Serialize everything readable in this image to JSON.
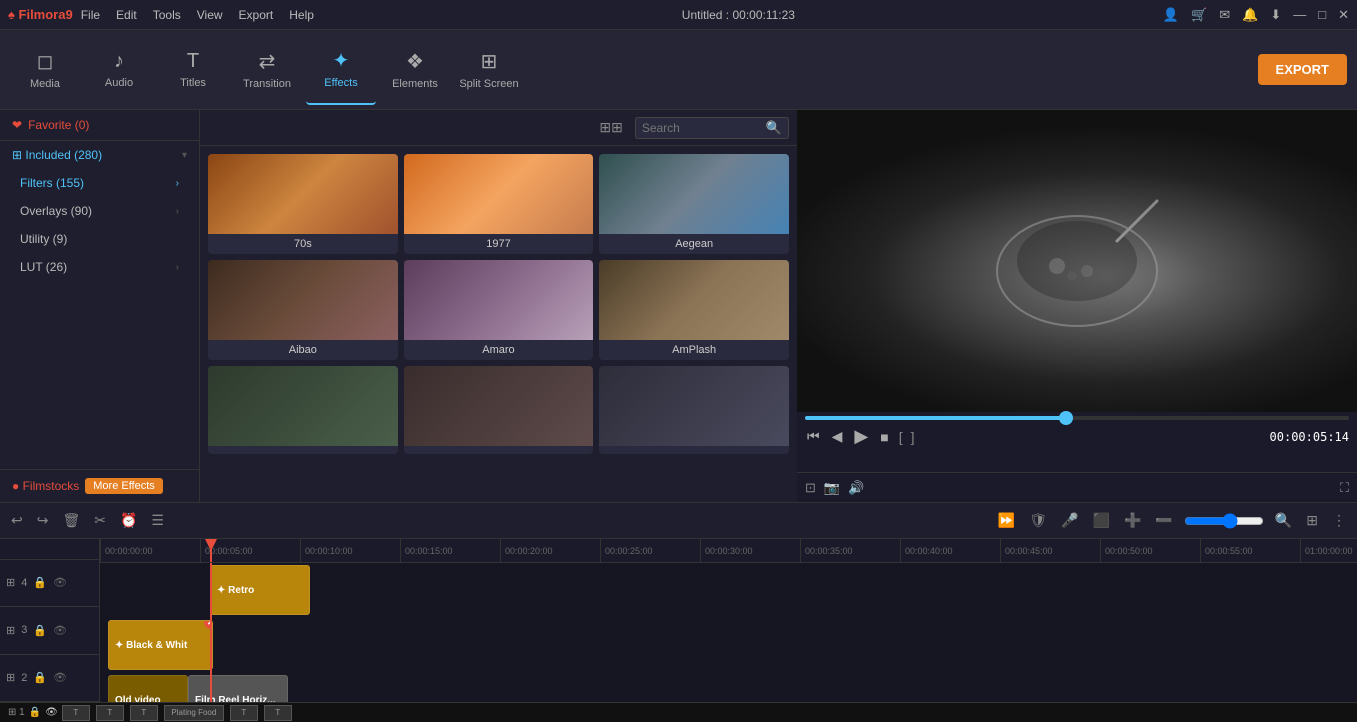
{
  "titlebar": {
    "logo": "♠ Filmora9",
    "menus": [
      "File",
      "Edit",
      "Tools",
      "View",
      "Export",
      "Help"
    ],
    "title": "Untitled : 00:00:11:23",
    "controls": [
      "👤",
      "🛒",
      "✉",
      "🔔",
      "⬇",
      "—",
      "□",
      "✕"
    ]
  },
  "toolbar": {
    "buttons": [
      {
        "id": "media",
        "icon": "◻",
        "label": "Media"
      },
      {
        "id": "audio",
        "icon": "♪",
        "label": "Audio"
      },
      {
        "id": "titles",
        "icon": "T",
        "label": "Titles"
      },
      {
        "id": "transition",
        "icon": "⇄",
        "label": "Transition"
      },
      {
        "id": "effects",
        "icon": "✦",
        "label": "Effects"
      },
      {
        "id": "elements",
        "icon": "❖",
        "label": "Elements"
      },
      {
        "id": "split-screen",
        "icon": "⊞",
        "label": "Split Screen"
      }
    ],
    "export_label": "EXPORT"
  },
  "left_panel": {
    "favorite": "❤ Favorite (0)",
    "categories": [
      {
        "label": "Included (280)",
        "arrow": "▾",
        "active": true
      },
      {
        "label": "Filters (155)",
        "arrow": "›",
        "active": true,
        "indent": true
      },
      {
        "label": "Overlays (90)",
        "arrow": "›",
        "indent": true
      },
      {
        "label": "Utility (9)",
        "indent": true
      },
      {
        "label": "LUT (26)",
        "arrow": "›",
        "indent": true
      }
    ],
    "filmstocks_label": "● Filmstocks",
    "more_effects_label": "More Effects"
  },
  "effects": {
    "search_placeholder": "Search",
    "cards": [
      {
        "name": "70s",
        "class": "thumb-70s"
      },
      {
        "name": "1977",
        "class": "thumb-1977"
      },
      {
        "name": "Aegean",
        "class": "thumb-aegean"
      },
      {
        "name": "Aibao",
        "class": "thumb-aibao"
      },
      {
        "name": "Amaro",
        "class": "thumb-amaro"
      },
      {
        "name": "AmPlash",
        "class": "thumb-amplash"
      },
      {
        "name": "",
        "class": "thumb-more1"
      },
      {
        "name": "",
        "class": "thumb-more2"
      },
      {
        "name": "",
        "class": "thumb-more3"
      }
    ]
  },
  "preview": {
    "time": "00:00:05:14",
    "bracket_left": "[",
    "bracket_right": "]"
  },
  "timeline": {
    "toolbar_icons": [
      "↩",
      "↪",
      "🗑",
      "✂",
      "⏰",
      "☰"
    ],
    "ruler_marks": [
      "00:00:00:00",
      "00:00:05:00",
      "00:00:10:00",
      "00:00:15:00",
      "00:00:20:00",
      "00:00:25:00",
      "00:00:30:00",
      "00:00:35:00",
      "00:00:40:00",
      "00:00:45:00",
      "00:00:50:00",
      "00:00:55:00",
      "01:00:00:00"
    ],
    "tracks": [
      {
        "num": "4",
        "icon": "⊞"
      },
      {
        "num": "3",
        "icon": "⊞"
      },
      {
        "num": "2",
        "icon": "⊞"
      }
    ],
    "clips": [
      {
        "label": "✦ Retro",
        "class": "clip-retro",
        "has_delete": false
      },
      {
        "label": "✦ Black & Whit",
        "class": "clip-bw",
        "has_delete": true
      },
      {
        "label": "Old video",
        "class": "clip-old",
        "has_delete": false
      },
      {
        "label": "Film Reel Horiz...",
        "class": "clip-filmreel",
        "has_delete": false
      }
    ],
    "bottom_labels": [
      "T",
      "T",
      "T",
      "Plating Food",
      "T",
      "T"
    ]
  }
}
